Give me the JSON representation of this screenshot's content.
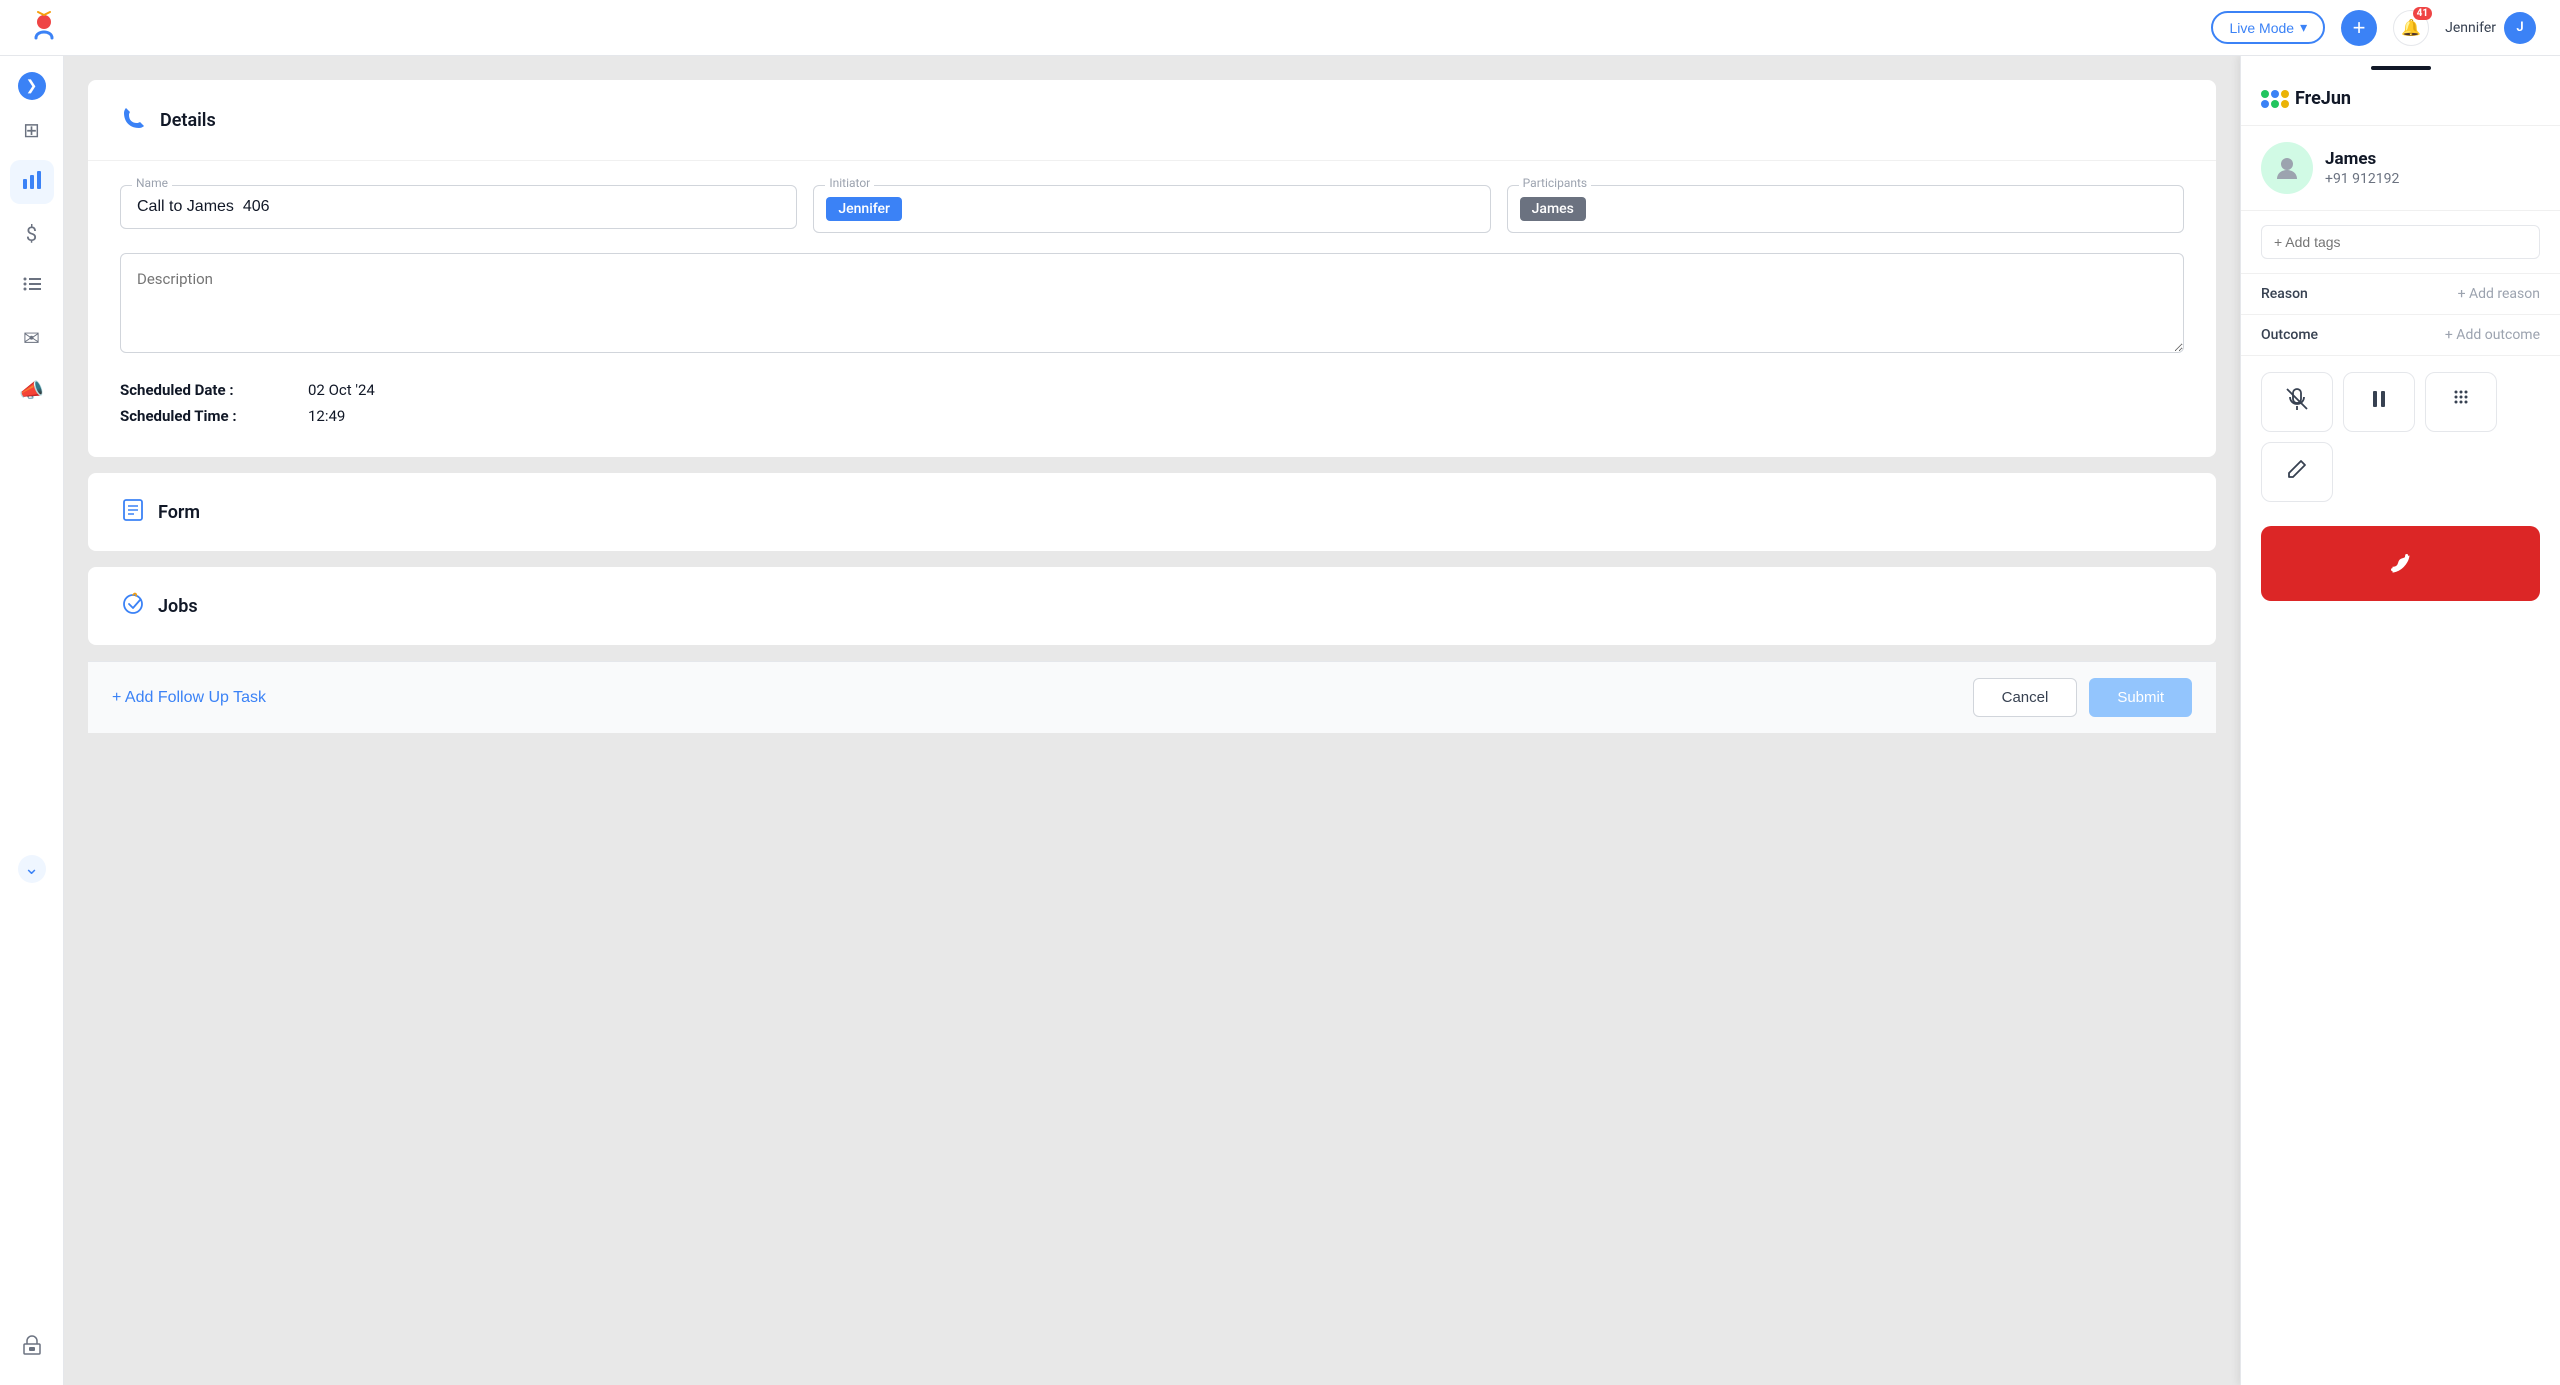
{
  "topNav": {
    "liveModeLabel": "Live Mode",
    "plusIcon": "+",
    "notifCount": "41",
    "userName": "Jennifer",
    "userInitial": "J"
  },
  "sidebar": {
    "items": [
      {
        "id": "expand",
        "icon": "❯",
        "label": "expand"
      },
      {
        "id": "grid",
        "icon": "⊞",
        "label": "dashboard"
      },
      {
        "id": "chart",
        "icon": "📊",
        "label": "reports"
      },
      {
        "id": "dollar",
        "icon": "💲",
        "label": "billing"
      },
      {
        "id": "list",
        "icon": "☰",
        "label": "tasks"
      },
      {
        "id": "mail",
        "icon": "✉",
        "label": "messages"
      },
      {
        "id": "megaphone",
        "icon": "📣",
        "label": "campaigns"
      },
      {
        "id": "chevron-down",
        "icon": "⌄",
        "label": "more"
      },
      {
        "id": "bag",
        "icon": "🛍",
        "label": "store"
      }
    ]
  },
  "details": {
    "sectionTitle": "Details",
    "nameLabel": "Name",
    "nameValue": "Call to James  406",
    "initiatorLabel": "Initiator",
    "initiatorChip": "Jennifer",
    "participantsLabel": "Participants",
    "participantsChip": "James",
    "descriptionPlaceholder": "Description",
    "scheduledDateLabel": "Scheduled Date :",
    "scheduledDateValue": "02 Oct '24",
    "scheduledTimeLabel": "Scheduled Time :",
    "scheduledTimeValue": "12:49"
  },
  "form": {
    "sectionTitle": "Form"
  },
  "jobs": {
    "sectionTitle": "Jobs"
  },
  "bottomBar": {
    "addFollowUpLabel": "+ Add Follow Up Task",
    "cancelLabel": "Cancel",
    "submitLabel": "Submit"
  },
  "frejunPanel": {
    "brandName": "FreJun",
    "contactName": "James",
    "contactPhone": "+91 912192",
    "tagsPlaceholder": "+ Add tags",
    "reasonLabel": "Reason",
    "reasonAction": "+ Add reason",
    "outcomeLabel": "Outcome",
    "outcomeAction": "+ Add outcome",
    "muteIcon": "🎤",
    "pauseIcon": "⏸",
    "dialpadIcon": "⠿",
    "editIcon": "✏",
    "endCallIcon": "📞"
  }
}
